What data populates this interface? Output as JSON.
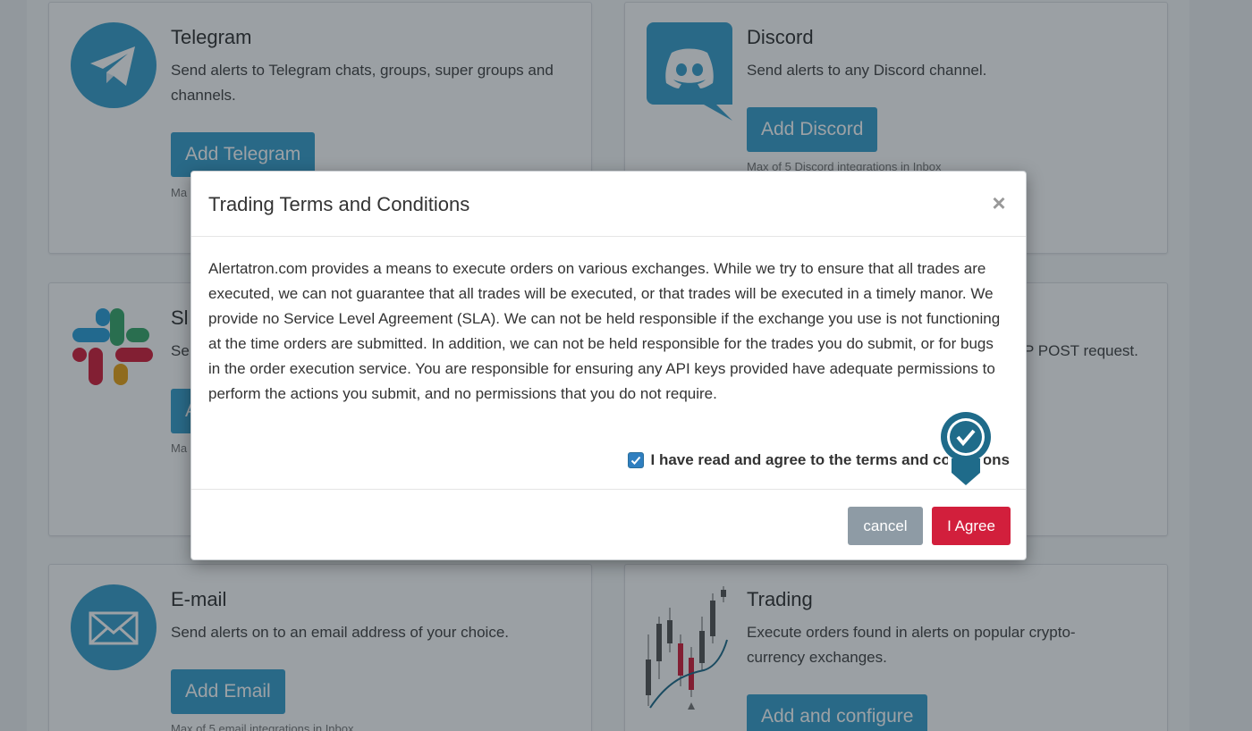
{
  "cards": {
    "telegram": {
      "title": "Telegram",
      "description": "Send alerts to Telegram chats, groups, super groups and channels.",
      "button_label": "Add Telegram",
      "note": "Ma"
    },
    "discord": {
      "title": "Discord",
      "description": "Send alerts to any Discord channel.",
      "button_label": "Add Discord",
      "note": "Max of 5 Discord integrations in Inbox"
    },
    "slack": {
      "title": "Sl",
      "description": "Se",
      "button_label": "A",
      "note": "Ma"
    },
    "webhook": {
      "description": "P POST request."
    },
    "email": {
      "title": "E-mail",
      "description": "Send alerts on to an email address of your choice.",
      "button_label": "Add Email",
      "note": "Max of 5 email integrations in Inbox"
    },
    "trading": {
      "title": "Trading",
      "description": "Execute orders found in alerts on popular crypto-currency exchanges.",
      "button_label": "Add and configure"
    }
  },
  "modal": {
    "title": "Trading Terms and Conditions",
    "close_label": "×",
    "body": "Alertatron.com provides a means to execute orders on various exchanges. While we try to ensure that all trades are executed, we can not guarantee that all trades will be executed, or that trades will be executed in a timely manor. We provide no Service Level Agreement (SLA). We can not be held responsible if the exchange you use is not functioning at the time orders are submitted. In addition, we can not be held responsible for the trades you do submit, or for bugs in the order execution service. You are responsible for ensuring any API keys provided have adequate permissions to perform the actions you submit, and no permissions that you do not require.",
    "agree_checkbox_label": "I have read and agree to the terms and conditions",
    "agree_checked": true,
    "cancel_label": "cancel",
    "agree_label": "I Agree"
  },
  "colors": {
    "primary_button": "#3a9fcb",
    "agree_button": "#d21f3c",
    "cancel_button": "#8e9ba5",
    "pin_marker": "#1f6b8a"
  },
  "icons": {
    "telegram": "telegram-icon",
    "discord": "discord-icon",
    "slack": "slack-icon",
    "email": "envelope-icon",
    "trading": "candlestick-chart-icon",
    "pin": "check-pin-icon"
  }
}
